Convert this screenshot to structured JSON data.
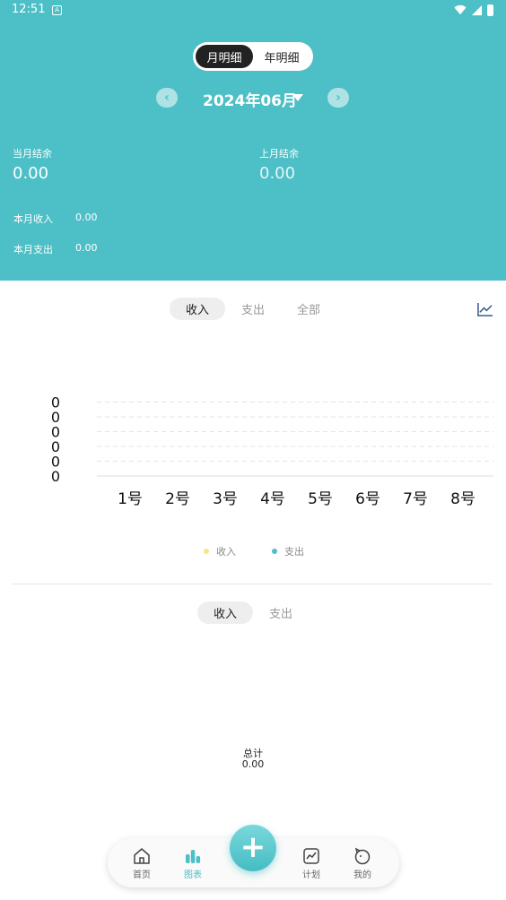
{
  "status": {
    "time": "12:51",
    "a_badge": "A"
  },
  "header": {
    "segment": [
      {
        "label": "月明细",
        "active": true
      },
      {
        "label": "年明细",
        "active": false
      }
    ],
    "month": "2024年06月",
    "current_balance_label": "当月结余",
    "current_balance_value": "0.00",
    "last_balance_label": "上月结余",
    "last_balance_value": "0.00",
    "income_label": "本月收入",
    "income_value": "0.00",
    "expense_label": "本月支出",
    "expense_value": "0.00"
  },
  "chart_tabs": [
    {
      "label": "收入",
      "active": true
    },
    {
      "label": "支出",
      "active": false
    },
    {
      "label": "全部",
      "active": false
    }
  ],
  "chart_data": {
    "type": "line",
    "categories": [
      "1号",
      "2号",
      "3号",
      "4号",
      "5号",
      "6号",
      "7号",
      "8号"
    ],
    "y_tick_labels": [
      "0",
      "0",
      "0",
      "0",
      "0",
      "0"
    ],
    "series": [
      {
        "name": "收入",
        "values": [
          0,
          0,
          0,
          0,
          0,
          0,
          0,
          0
        ],
        "color": "#fce38a"
      },
      {
        "name": "支出",
        "values": [
          0,
          0,
          0,
          0,
          0,
          0,
          0,
          0
        ],
        "color": "#4dbfc6"
      }
    ],
    "ylim": [
      0,
      0
    ],
    "grid": true,
    "legend": "bottom"
  },
  "pie_tabs": [
    {
      "label": "收入",
      "active": true
    },
    {
      "label": "支出",
      "active": false
    }
  ],
  "total": {
    "label": "总计",
    "value": "0.00"
  },
  "nav": {
    "home": "首页",
    "chart": "图表",
    "plan": "计划",
    "mine": "我的"
  },
  "colors": {
    "accent": "#4dbfc6",
    "income": "#fce38a",
    "expense": "#4dbfc6"
  }
}
